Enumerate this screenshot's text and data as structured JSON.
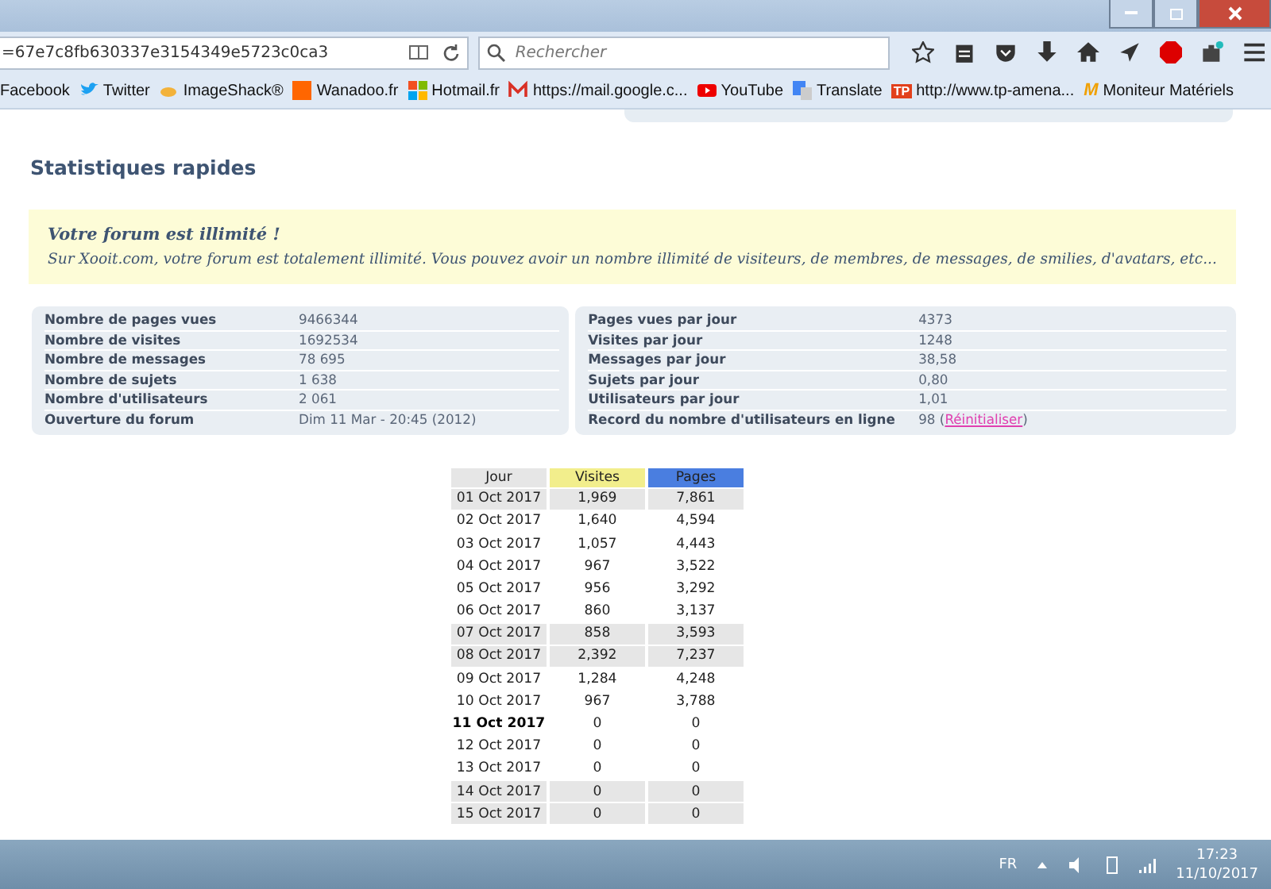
{
  "browser": {
    "url": "=67e7c8fb630337e3154349e5723c0ca3",
    "search": {
      "placeholder": "Rechercher"
    },
    "bookmarks": [
      {
        "label": "Facebook"
      },
      {
        "label": "Twitter",
        "kind": "bird"
      },
      {
        "label": "ImageShack®",
        "kind": "shack"
      },
      {
        "label": "Wanadoo.fr",
        "kind": "orange"
      },
      {
        "label": "Hotmail.fr",
        "kind": "windows"
      },
      {
        "label": "https://mail.google.c...",
        "kind": "mail"
      },
      {
        "label": "YouTube",
        "kind": "play"
      },
      {
        "label": "Translate",
        "kind": "translate"
      },
      {
        "label": "http://www.tp-amena...",
        "kind": "tp",
        "icon_text": "TP"
      },
      {
        "label": "Moniteur Matériels",
        "kind": "m",
        "icon_text": "M"
      }
    ]
  },
  "section_title": "Statistiques rapides",
  "notice": {
    "title": "Votre forum est illimité !",
    "text": "Sur Xooit.com, votre forum est totalement illimité. Vous pouvez avoir un nombre illimité de visiteurs, de membres, de messages, de smilies, d'avatars, etc..."
  },
  "stats_left": [
    {
      "label": "Nombre de pages vues",
      "value": "9466344"
    },
    {
      "label": "Nombre de visites",
      "value": "1692534"
    },
    {
      "label": "Nombre de messages",
      "value": "78 695"
    },
    {
      "label": "Nombre de sujets",
      "value": "1 638"
    },
    {
      "label": "Nombre d'utilisateurs",
      "value": "2 061"
    },
    {
      "label": "Ouverture du forum",
      "value": "Dim 11 Mar - 20:45 (2012)"
    }
  ],
  "stats_right": [
    {
      "label": "Pages vues par jour",
      "value": "4373"
    },
    {
      "label": "Visites par jour",
      "value": "1248"
    },
    {
      "label": "Messages par jour",
      "value": "38,58"
    },
    {
      "label": "Sujets par jour",
      "value": "0,80"
    },
    {
      "label": "Utilisateurs par jour",
      "value": "1,01"
    },
    {
      "label": "Record du nombre d'utilisateurs en ligne",
      "value": "98",
      "link_open": "(",
      "link": "Réinitialiser",
      "link_close": ")"
    }
  ],
  "daily_table": {
    "columns": [
      {
        "label": "Jour",
        "color": "#e6e6e6"
      },
      {
        "label": "Visites",
        "color": "#f2ee8c"
      },
      {
        "label": "Pages",
        "color": "#4a7ee0"
      }
    ],
    "rows": [
      {
        "day": "01 Oct 2017",
        "visits": "1,969",
        "pages": "7,861",
        "weekend": true,
        "today": false
      },
      {
        "day": "02 Oct 2017",
        "visits": "1,640",
        "pages": "4,594",
        "weekend": false,
        "today": false
      },
      {
        "day": "03 Oct 2017",
        "visits": "1,057",
        "pages": "4,443",
        "weekend": false,
        "today": false
      },
      {
        "day": "04 Oct 2017",
        "visits": "967",
        "pages": "3,522",
        "weekend": false,
        "today": false
      },
      {
        "day": "05 Oct 2017",
        "visits": "956",
        "pages": "3,292",
        "weekend": false,
        "today": false
      },
      {
        "day": "06 Oct 2017",
        "visits": "860",
        "pages": "3,137",
        "weekend": false,
        "today": false
      },
      {
        "day": "07 Oct 2017",
        "visits": "858",
        "pages": "3,593",
        "weekend": true,
        "today": false
      },
      {
        "day": "08 Oct 2017",
        "visits": "2,392",
        "pages": "7,237",
        "weekend": true,
        "today": false
      },
      {
        "day": "09 Oct 2017",
        "visits": "1,284",
        "pages": "4,248",
        "weekend": false,
        "today": false
      },
      {
        "day": "10 Oct 2017",
        "visits": "967",
        "pages": "3,788",
        "weekend": false,
        "today": false
      },
      {
        "day": "11 Oct 2017",
        "visits": "0",
        "pages": "0",
        "weekend": false,
        "today": true
      },
      {
        "day": "12 Oct 2017",
        "visits": "0",
        "pages": "0",
        "weekend": false,
        "today": false
      },
      {
        "day": "13 Oct 2017",
        "visits": "0",
        "pages": "0",
        "weekend": false,
        "today": false
      },
      {
        "day": "14 Oct 2017",
        "visits": "0",
        "pages": "0",
        "weekend": true,
        "today": false
      },
      {
        "day": "15 Oct 2017",
        "visits": "0",
        "pages": "0",
        "weekend": true,
        "today": false
      }
    ]
  },
  "taskbar": {
    "language": "FR",
    "time": "17:23",
    "date": "11/10/2017"
  }
}
